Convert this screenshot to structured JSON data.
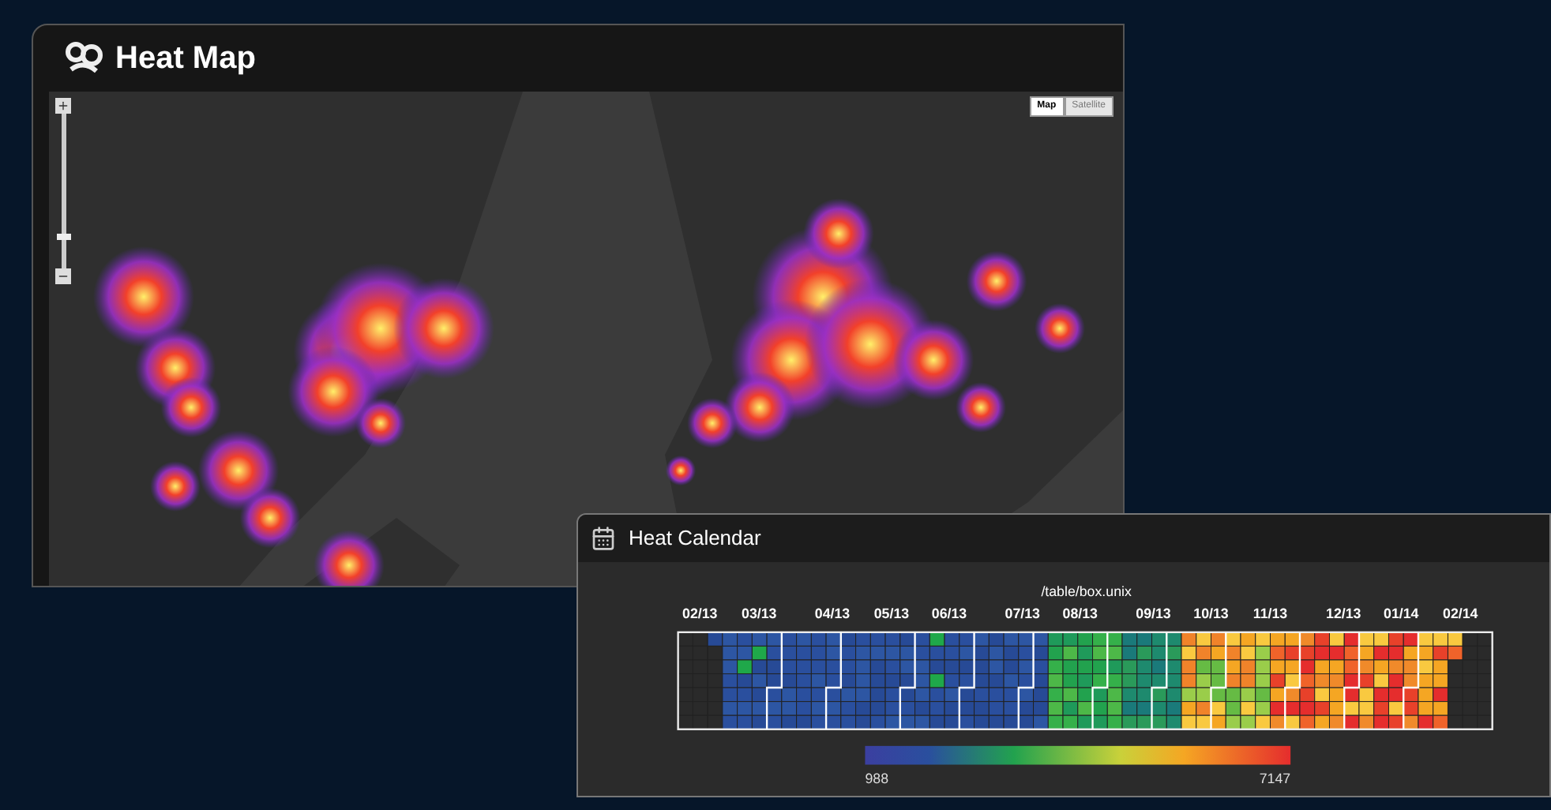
{
  "heat_map": {
    "title": "Heat Map",
    "zoom": {
      "level": 0.2
    },
    "map_types": [
      {
        "label": "Map",
        "selected": true
      },
      {
        "label": "Satellite",
        "selected": false
      }
    ]
  },
  "heat_calendar": {
    "title": "Heat Calendar",
    "subtitle": "/table/box.unix",
    "months": [
      "02/13",
      "03/13",
      "04/13",
      "05/13",
      "06/13",
      "07/13",
      "08/13",
      "09/13",
      "10/13",
      "11/13",
      "12/13",
      "01/14",
      "02/14"
    ],
    "legend": {
      "min": "988",
      "max": "7147"
    }
  }
}
